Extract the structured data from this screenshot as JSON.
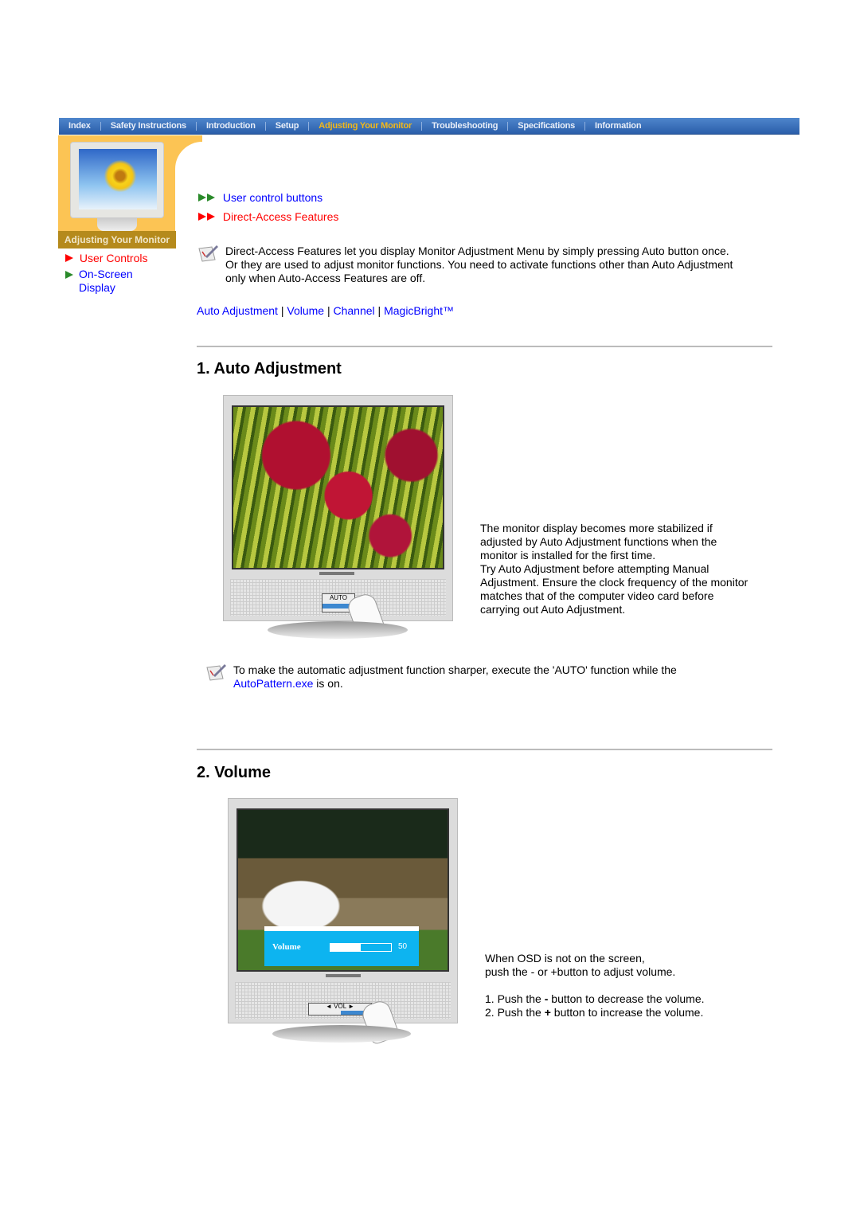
{
  "nav": {
    "items": [
      "Index",
      "Safety Instructions",
      "Introduction",
      "Setup",
      "Adjusting Your Monitor",
      "Troubleshooting",
      "Specifications",
      "Information"
    ],
    "active": "Adjusting Your Monitor",
    "active_color": "#f2b81a",
    "bar_color": "#3a6fbb"
  },
  "sidebar": {
    "caption": "Adjusting Your Monitor",
    "items": [
      {
        "label": "User Controls",
        "color": "#ff0000"
      },
      {
        "label": "On-Screen Display",
        "color": "#0000ff"
      }
    ]
  },
  "sublinks": [
    {
      "label": "User control buttons",
      "color": "#0000ff"
    },
    {
      "label": "Direct-Access Features",
      "color": "#ff0000"
    }
  ],
  "intro": {
    "lines": [
      "Direct-Access Features let you display Monitor Adjustment Menu by simply pressing Auto button once.",
      "Or they are used to adjust monitor functions. You need to activate functions other than Auto Adjustment",
      "only when Auto-Access Features are off."
    ]
  },
  "anchors": [
    "Auto Adjustment",
    "Volume",
    "Channel",
    "MagicBright™"
  ],
  "sections": {
    "auto": {
      "title": "1. Auto Adjustment",
      "button": "AUTO",
      "text": [
        "The monitor display becomes more stabilized if",
        "adjusted by Auto Adjustment functions when the",
        "monitor is installed for the first time.",
        "Try Auto Adjustment before attempting Manual",
        "Adjustment. Ensure the clock frequency of the monitor",
        "matches that of the computer video card before",
        "carrying out Auto Adjustment."
      ],
      "note": {
        "before": "To make the automatic adjustment function sharper, execute the 'AUTO' function while the",
        "link": "AutoPattern.exe",
        "after": " is on."
      }
    },
    "volume": {
      "title": "2. Volume",
      "osd_label": "Volume",
      "osd_value": "50",
      "osd_level_percent": 50,
      "button": "VOL",
      "text": [
        "When OSD is not on the screen,",
        "push the - or +button to adjust volume."
      ],
      "steps": [
        {
          "a": "1. Push the ",
          "b": "-",
          "c": " button to decrease the volume."
        },
        {
          "a": "2. Push the ",
          "b": "+",
          "c": " button to increase the volume."
        }
      ]
    }
  }
}
